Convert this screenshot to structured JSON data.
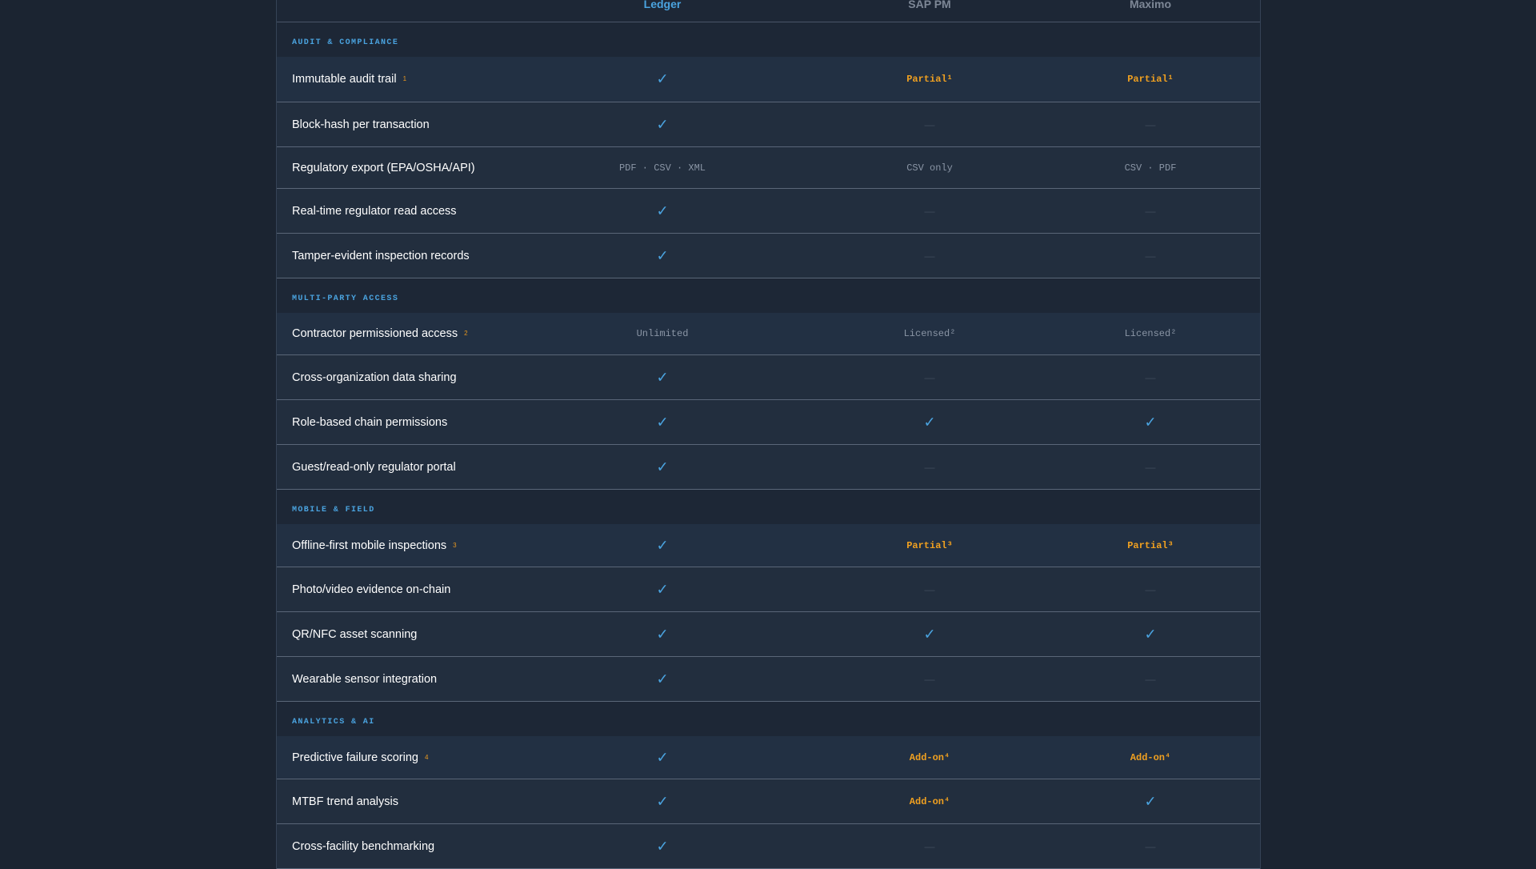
{
  "columns": {
    "c1": "Ledger",
    "c2": "SAP PM",
    "c3": "Maximo"
  },
  "sections": [
    {
      "label": "AUDIT & COMPLIANCE",
      "rows": [
        {
          "feature": "Immutable audit trail",
          "fn": "1",
          "c1": "✓",
          "c2": "Partial¹",
          "c3": "Partial¹"
        },
        {
          "feature": "Block-hash per transaction",
          "c1": "✓",
          "c2": "—",
          "c3": "—"
        },
        {
          "feature": "Regulatory export (EPA/OSHA/API)",
          "c1": "PDF · CSV · XML",
          "c2": "CSV only",
          "c3": "CSV · PDF"
        },
        {
          "feature": "Real-time regulator read access",
          "c1": "✓",
          "c2": "—",
          "c3": "—"
        },
        {
          "feature": "Tamper-evident inspection records",
          "c1": "✓",
          "c2": "—",
          "c3": "—"
        }
      ]
    },
    {
      "label": "MULTI-PARTY ACCESS",
      "rows": [
        {
          "feature": "Contractor permissioned access",
          "fn": "2",
          "c1": "Unlimited",
          "c2": "Licensed²",
          "c3": "Licensed²"
        },
        {
          "feature": "Cross-organization data sharing",
          "c1": "✓",
          "c2": "—",
          "c3": "—"
        },
        {
          "feature": "Role-based chain permissions",
          "c1": "✓",
          "c2": "✓",
          "c3": "✓"
        },
        {
          "feature": "Guest/read-only regulator portal",
          "c1": "✓",
          "c2": "—",
          "c3": "—"
        }
      ]
    },
    {
      "label": "MOBILE & FIELD",
      "rows": [
        {
          "feature": "Offline-first mobile inspections",
          "fn": "3",
          "c1": "✓",
          "c2": "Partial³",
          "c3": "Partial³"
        },
        {
          "feature": "Photo/video evidence on-chain",
          "c1": "✓",
          "c2": "—",
          "c3": "—"
        },
        {
          "feature": "QR/NFC asset scanning",
          "c1": "✓",
          "c2": "✓",
          "c3": "✓"
        },
        {
          "feature": "Wearable sensor integration",
          "c1": "✓",
          "c2": "—",
          "c3": "—"
        }
      ]
    },
    {
      "label": "ANALYTICS & AI",
      "rows": [
        {
          "feature": "Predictive failure scoring",
          "fn": "4",
          "c1": "✓",
          "c2": "Add-on⁴",
          "c3": "Add-on⁴"
        },
        {
          "feature": "MTBF trend analysis",
          "c1": "✓",
          "c2": "Add-on⁴",
          "c3": "✓"
        },
        {
          "feature": "Cross-facility benchmarking",
          "c1": "✓",
          "c2": "—",
          "c3": "—"
        }
      ]
    }
  ]
}
